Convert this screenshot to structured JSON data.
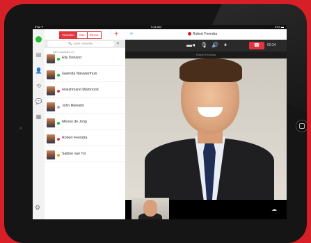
{
  "status": {
    "left": "iPad ✦",
    "time": "9:41 AM",
    "right": "91% ▬"
  },
  "tabs": [
    {
      "label": "Vrienden",
      "active": true
    },
    {
      "label": "Site",
      "active": false
    },
    {
      "label": "Phone",
      "active": false
    }
  ],
  "search": {
    "placeholder": "Zoek vrienden"
  },
  "section_label": "Alle contacten (7)",
  "contacts": [
    {
      "name": "Elly Dorland",
      "status": "online"
    },
    {
      "name": "Gwenda Nieuwenhuis",
      "status": "online"
    },
    {
      "name": "Hoeshmand Mahmood",
      "status": "busy"
    },
    {
      "name": "John Rietveld",
      "status": "offline"
    },
    {
      "name": "Menno de Jong",
      "status": "online"
    },
    {
      "name": "Robert Feendra",
      "status": "busy"
    },
    {
      "name": "Sabine van Tol",
      "status": "away"
    }
  ],
  "status_colors": {
    "online": "#22bb33",
    "busy": "#e2353c",
    "offline": "#aaaaaa",
    "away": "#f0a020"
  },
  "call": {
    "title": "Robert Feendra",
    "timer": "00:34",
    "subtitle": "Robert Feendra"
  },
  "icons": {
    "contacts": "👤",
    "history": "⟲",
    "chat": "💬",
    "dialpad": "▦",
    "settings": "⚙",
    "video_off": "▬◂",
    "mic": "🎙",
    "volume": "🔊",
    "pause": "⏸",
    "hangup": "☎",
    "cloud": "☁",
    "back": "⊳",
    "plus": "+",
    "filter": "▾"
  },
  "accent_color": "#e2353c"
}
